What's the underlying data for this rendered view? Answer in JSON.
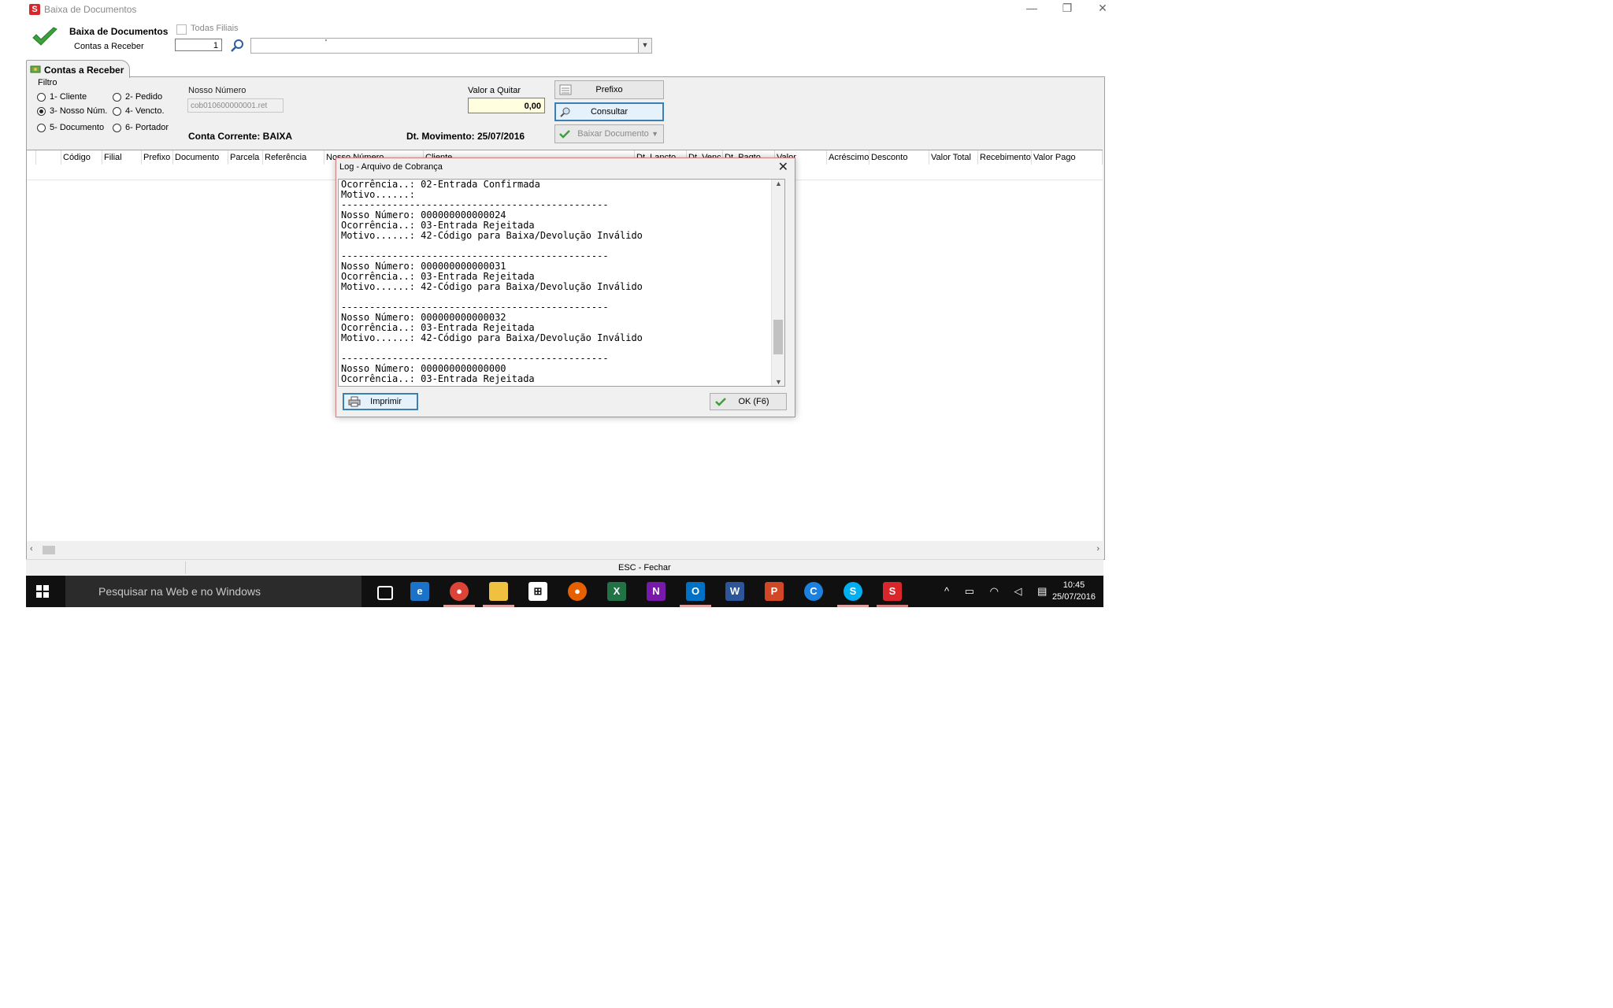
{
  "window": {
    "title": "Baixa de Documentos",
    "controls": [
      "—",
      "❐",
      "✕"
    ]
  },
  "header": {
    "title": "Baixa de Documentos",
    "subtitle": "Contas a Receber",
    "todas_filiais_label": "Todas Filiais",
    "filial_value": "1",
    "combo_value": "'"
  },
  "tab": {
    "label": "Contas a Receber"
  },
  "filtro": {
    "label": "Filtro",
    "options": [
      "1- Cliente",
      "2- Pedido",
      "3- Nosso Núm.",
      "4- Vencto.",
      "5- Documento",
      "6- Portador"
    ],
    "selected": "3- Nosso Núm."
  },
  "nosso_numero": {
    "label": "Nosso Número",
    "value": "cob010600000001.ret"
  },
  "conta_corrente": "Conta Corrente: BAIXA",
  "dt_movimento": "Dt. Movimento: 25/07/2016",
  "valor_quitar": {
    "label": "Valor a Quitar",
    "value": "0,00"
  },
  "buttons": {
    "prefixo": "Prefixo",
    "consultar": "Consultar",
    "baixar": "Baixar Documento"
  },
  "grid": {
    "columns": [
      "Código",
      "Filial",
      "Prefixo",
      "Documento",
      "Parcela",
      "Referência",
      "Nosso Número",
      "Cliente",
      "Dt. Lancto",
      "Dt. Venc",
      "Dt. Pagto",
      "Valor",
      "Acréscimo",
      "Desconto",
      "Valor Total",
      "Recebimento",
      "Valor Pago"
    ]
  },
  "status_bar": {
    "text": "ESC - Fechar"
  },
  "dialog": {
    "title": "Log - Arquivo de Cobrança",
    "log_lines": [
      "Ocorrência..: 02-Entrada Confirmada",
      "Motivo......:",
      "-----------------------------------------------",
      "Nosso Número: 000000000000024",
      "Ocorrência..: 03-Entrada Rejeitada",
      "Motivo......: 42-Código para Baixa/Devolução Inválido",
      "",
      "-----------------------------------------------",
      "Nosso Número: 000000000000031",
      "Ocorrência..: 03-Entrada Rejeitada",
      "Motivo......: 42-Código para Baixa/Devolução Inválido",
      "",
      "-----------------------------------------------",
      "Nosso Número: 000000000000032",
      "Ocorrência..: 03-Entrada Rejeitada",
      "Motivo......: 42-Código para Baixa/Devolução Inválido",
      "",
      "-----------------------------------------------",
      "Nosso Número: 000000000000000",
      "Ocorrência..: 03-Entrada Rejeitada"
    ],
    "imprimir_label": "Imprimir",
    "ok_label": "OK (F6)"
  },
  "taskbar": {
    "search_placeholder": "Pesquisar na Web e no Windows",
    "apps": [
      "task-view",
      "edge",
      "chrome",
      "file-explorer",
      "store",
      "firefox",
      "excel",
      "onenote",
      "outlook",
      "word",
      "powerpoint",
      "ccleaner",
      "skype",
      "app-s"
    ],
    "time": "10:45",
    "date": "25/07/2016"
  },
  "colors": {
    "accent_blue": "#3c7fb1",
    "valor_bg": "#ffffe0",
    "taskbar": "#101010"
  }
}
